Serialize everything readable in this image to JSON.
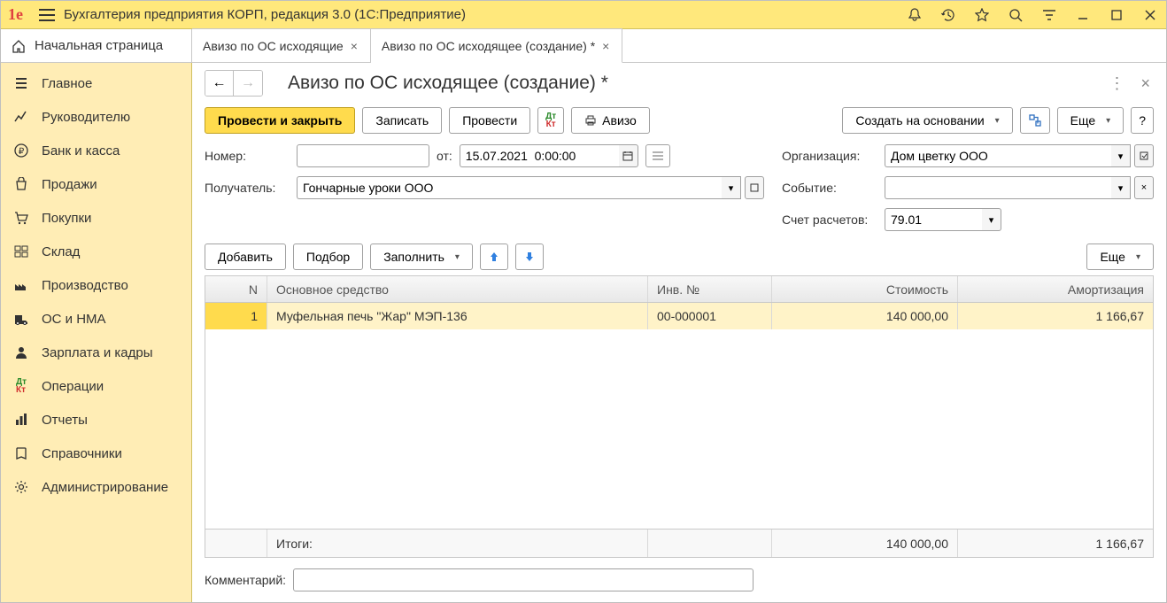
{
  "titlebar": {
    "title": "Бухгалтерия предприятия КОРП, редакция 3.0  (1С:Предприятие)"
  },
  "tabs": {
    "home": "Начальная страница",
    "items": [
      {
        "label": "Авизо по ОС исходящие",
        "active": false
      },
      {
        "label": "Авизо по ОС исходящее (создание) *",
        "active": true
      }
    ]
  },
  "sidebar": {
    "items": [
      "Главное",
      "Руководителю",
      "Банк и касса",
      "Продажи",
      "Покупки",
      "Склад",
      "Производство",
      "ОС и НМА",
      "Зарплата и кадры",
      "Операции",
      "Отчеты",
      "Справочники",
      "Администрирование"
    ]
  },
  "page": {
    "title": "Авизо по ОС исходящее (создание) *"
  },
  "toolbar": {
    "post_close": "Провести и закрыть",
    "write": "Записать",
    "post": "Провести",
    "aviso": "Авизо",
    "create_based": "Создать на основании",
    "more": "Еще",
    "help": "?"
  },
  "form": {
    "number_label": "Номер:",
    "number_value": "",
    "from_label": "от:",
    "date_value": "15.07.2021  0:00:00",
    "org_label": "Организация:",
    "org_value": "Дом цветку ООО",
    "recipient_label": "Получатель:",
    "recipient_value": "Гончарные уроки ООО",
    "event_label": "Событие:",
    "event_value": "",
    "account_label": "Счет расчетов:",
    "account_value": "79.01"
  },
  "table_toolbar": {
    "add": "Добавить",
    "pick": "Подбор",
    "fill": "Заполнить",
    "more": "Еще"
  },
  "table": {
    "head": {
      "n": "N",
      "name": "Основное средство",
      "inv": "Инв. №",
      "cost": "Стоимость",
      "amort": "Амортизация"
    },
    "rows": [
      {
        "n": "1",
        "name": "Муфельная печь \"Жар\" МЭП-136",
        "inv": "00-000001",
        "cost": "140 000,00",
        "amort": "1 166,67"
      }
    ],
    "foot": {
      "label": "Итоги:",
      "cost": "140 000,00",
      "amort": "1 166,67"
    }
  },
  "comment": {
    "label": "Комментарий:",
    "value": ""
  }
}
